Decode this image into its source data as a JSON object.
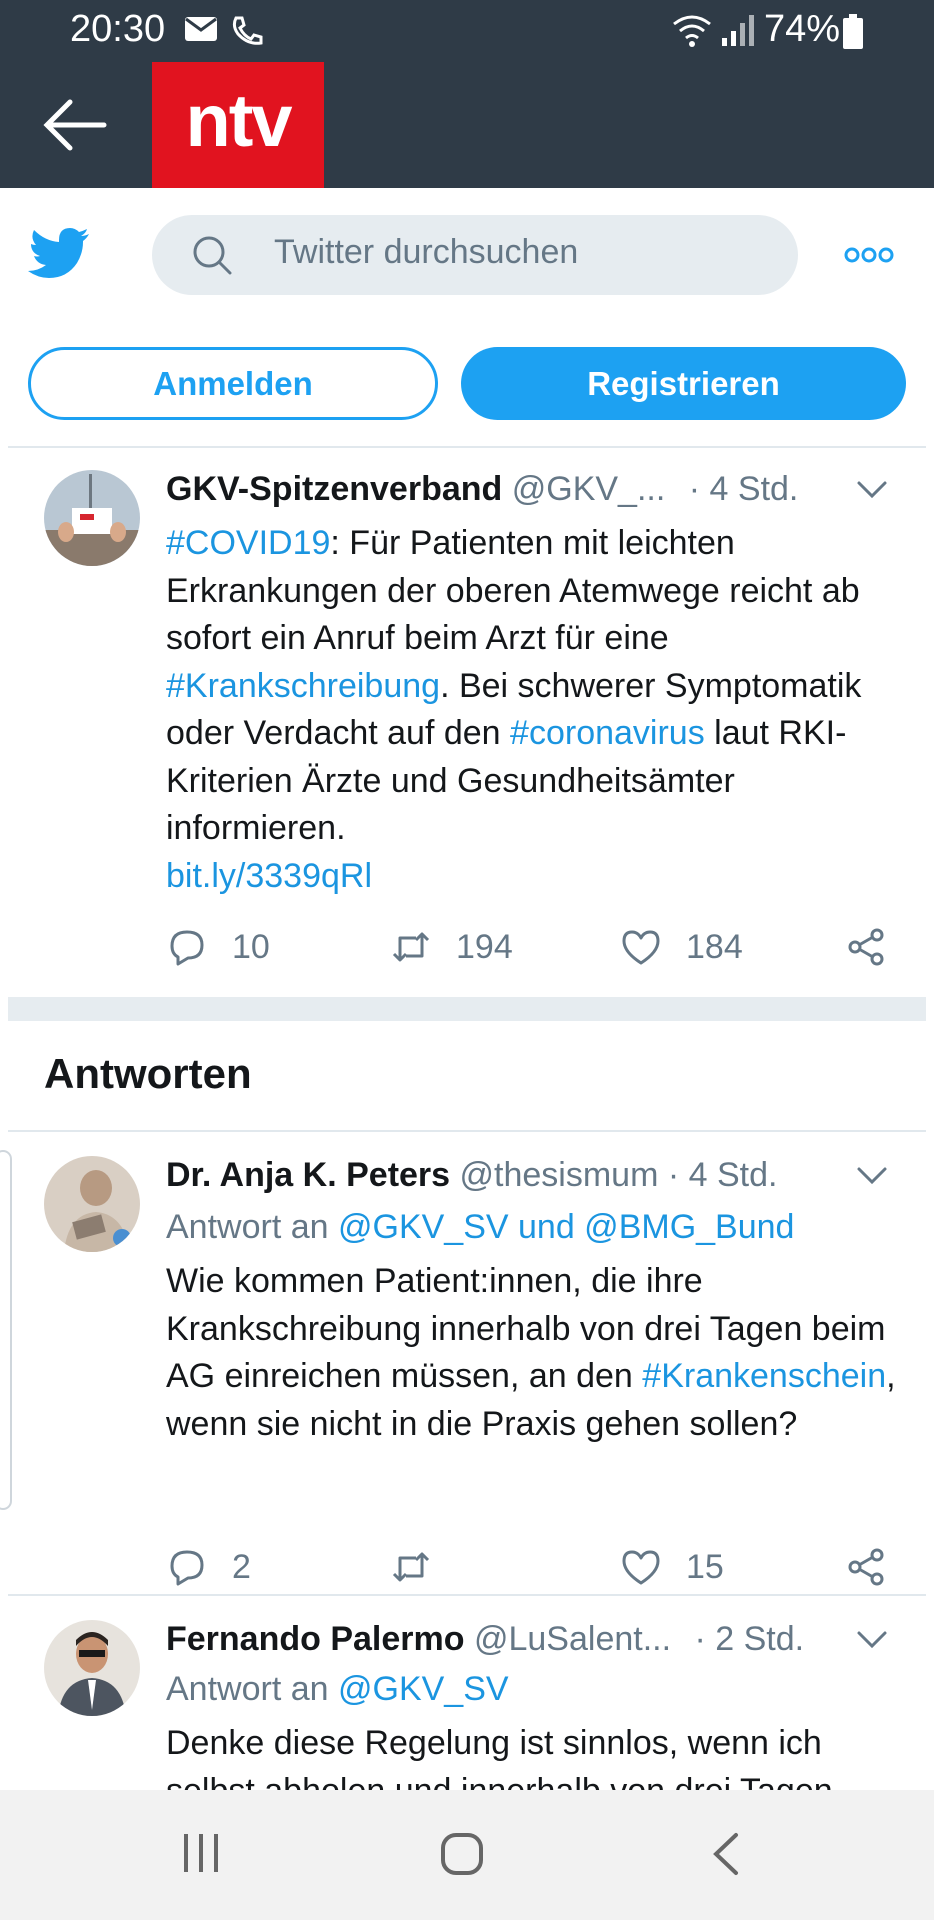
{
  "status_bar": {
    "time": "20:30",
    "battery": "74%"
  },
  "app": {
    "logo_text": "ntv"
  },
  "twitter": {
    "search_placeholder": "Twitter durchsuchen",
    "login_label": "Anmelden",
    "register_label": "Registrieren"
  },
  "main_tweet": {
    "name": "GKV-Spitzenverband",
    "handle": "@GKV_...",
    "time": "· 4 Std.",
    "hashtag1": "#COVID19",
    "text1": ": Für Patienten mit leichten Erkrankungen der oberen Atemwege reicht ab sofort ein Anruf beim Arzt für eine ",
    "hashtag2": "#Krankschreibung",
    "text2": ". Bei schwerer Symptomatik oder Verdacht auf den ",
    "hashtag3": "#coronavirus",
    "text3": " laut RKI-Kriterien Ärzte und Gesundheitsämter informieren.",
    "link": "bit.ly/3339qRl",
    "replies": "10",
    "retweets": "194",
    "likes": "184"
  },
  "replies_section": {
    "title": "Antworten"
  },
  "reply1": {
    "name": "Dr. Anja K. Peters",
    "handle": "@thesismum",
    "time": "· 4 Std.",
    "reply_prefix": "Antwort an ",
    "reply_targets": "@GKV_SV und @BMG_Bund",
    "text1": "Wie kommen Patient:innen, die ihre Krankschreibung innerhalb von drei Tagen beim AG einreichen müssen, an den ",
    "hashtag": "#Krankenschein",
    "text2": ", wenn sie nicht in die Praxis gehen sollen?",
    "replies": "2",
    "likes": "15"
  },
  "reply2": {
    "name": "Fernando Palermo",
    "handle": "@LuSalent...",
    "time": "· 2 Std.",
    "reply_prefix": "Antwort an ",
    "reply_targets": "@GKV_SV",
    "text": "Denke diese Regelung ist sinnlos, wenn ich selbst abholen und innerhalb von drei Tagen"
  },
  "colors": {
    "twitter_blue": "#1da1f2",
    "ntv_red": "#e1131f",
    "app_bar": "#2f3b47"
  }
}
